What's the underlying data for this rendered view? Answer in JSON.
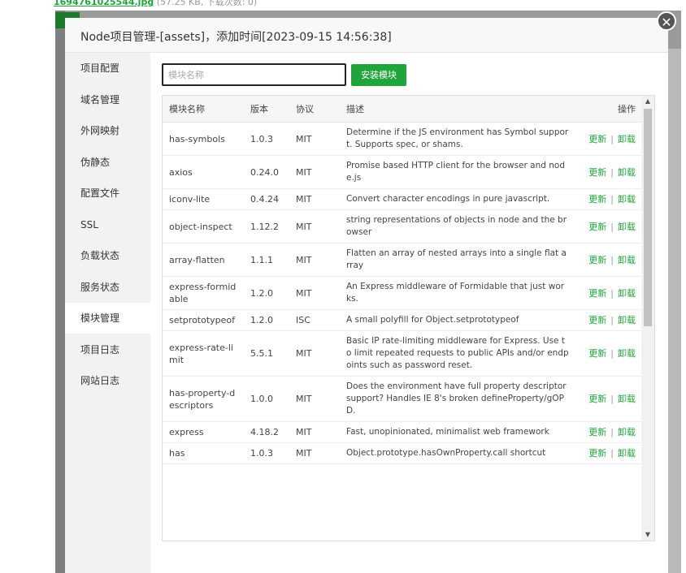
{
  "background": {
    "file_link": "1694761025544.jpg",
    "file_meta": "(57.25 KB, 下载次数: 0)"
  },
  "modal": {
    "title": "Node项目管理-[assets]，添加时间[2023-09-15 14:56:38]",
    "close_glyph": "✕"
  },
  "sidebar": {
    "items": [
      {
        "label": "项目配置"
      },
      {
        "label": "域名管理"
      },
      {
        "label": "外网映射"
      },
      {
        "label": "伪静态"
      },
      {
        "label": "配置文件"
      },
      {
        "label": "SSL"
      },
      {
        "label": "负载状态"
      },
      {
        "label": "服务状态"
      },
      {
        "label": "模块管理",
        "active": true
      },
      {
        "label": "项目日志"
      },
      {
        "label": "网站日志"
      }
    ]
  },
  "toolbar": {
    "search_placeholder": "模块名称",
    "install_label": "安装模块"
  },
  "table": {
    "headers": {
      "name": "模块名称",
      "version": "版本",
      "license": "协议",
      "desc": "描述",
      "op": "操作"
    },
    "action_update": "更新",
    "action_sep": "|",
    "action_uninstall": "卸载",
    "rows": [
      {
        "name": "has-symbols",
        "version": "1.0.3",
        "license": "MIT",
        "desc": "Determine if the JS environment has Symbol support. Supports spec, or shams."
      },
      {
        "name": "axios",
        "version": "0.24.0",
        "license": "MIT",
        "desc": "Promise based HTTP client for the browser and node.js"
      },
      {
        "name": "iconv-lite",
        "version": "0.4.24",
        "license": "MIT",
        "desc": "Convert character encodings in pure javascript."
      },
      {
        "name": "object-inspect",
        "version": "1.12.2",
        "license": "MIT",
        "desc": "string representations of objects in node and the browser"
      },
      {
        "name": "array-flatten",
        "version": "1.1.1",
        "license": "MIT",
        "desc": "Flatten an array of nested arrays into a single flat array"
      },
      {
        "name": "express-formidable",
        "version": "1.2.0",
        "license": "MIT",
        "desc": "An Express middleware of Formidable that just works."
      },
      {
        "name": "setprototypeof",
        "version": "1.2.0",
        "license": "ISC",
        "desc": "A small polyfill for Object.setprototypeof"
      },
      {
        "name": "express-rate-limit",
        "version": "5.5.1",
        "license": "MIT",
        "desc": "Basic IP rate-limiting middleware for Express. Use to limit repeated requests to public APIs and/or endpoints such as password reset."
      },
      {
        "name": "has-property-descriptors",
        "version": "1.0.0",
        "license": "MIT",
        "desc": "Does the environment have full property descriptor support? Handles IE 8's broken defineProperty/gOPD."
      },
      {
        "name": "express",
        "version": "4.18.2",
        "license": "MIT",
        "desc": "Fast, unopinionated, minimalist web framework"
      },
      {
        "name": "has",
        "version": "1.0.3",
        "license": "MIT",
        "desc": "Object.prototype.hasOwnProperty.call shortcut"
      }
    ]
  }
}
